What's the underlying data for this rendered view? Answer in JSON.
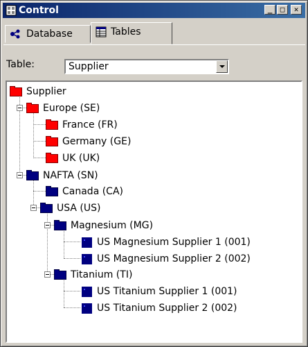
{
  "window": {
    "title": "Control"
  },
  "tabs": [
    {
      "label": "Database",
      "icon": "database-icon"
    },
    {
      "label": "Tables",
      "icon": "table-icon",
      "active": true
    }
  ],
  "table_field": {
    "label": "Table:",
    "value": "Supplier"
  },
  "tree": {
    "root": "Supplier",
    "europe": "Europe (SE)",
    "france": "France (FR)",
    "germany": "Germany (GE)",
    "uk": "UK (UK)",
    "nafta": "NAFTA (SN)",
    "canada": "Canada (CA)",
    "usa": "USA (US)",
    "magnesium": "Magnesium (MG)",
    "mg1": "US Magnesium Supplier 1 (001)",
    "mg2": "US Magnesium Supplier 2 (002)",
    "titanium": "Titanium (TI)",
    "ti1": "US Titanium Supplier 1 (001)",
    "ti2": "US Titanium Supplier 2 (002)"
  },
  "colors": {
    "title_bar": "#0a246a",
    "red_folder": "#ff0000",
    "blue_folder": "#000080"
  }
}
